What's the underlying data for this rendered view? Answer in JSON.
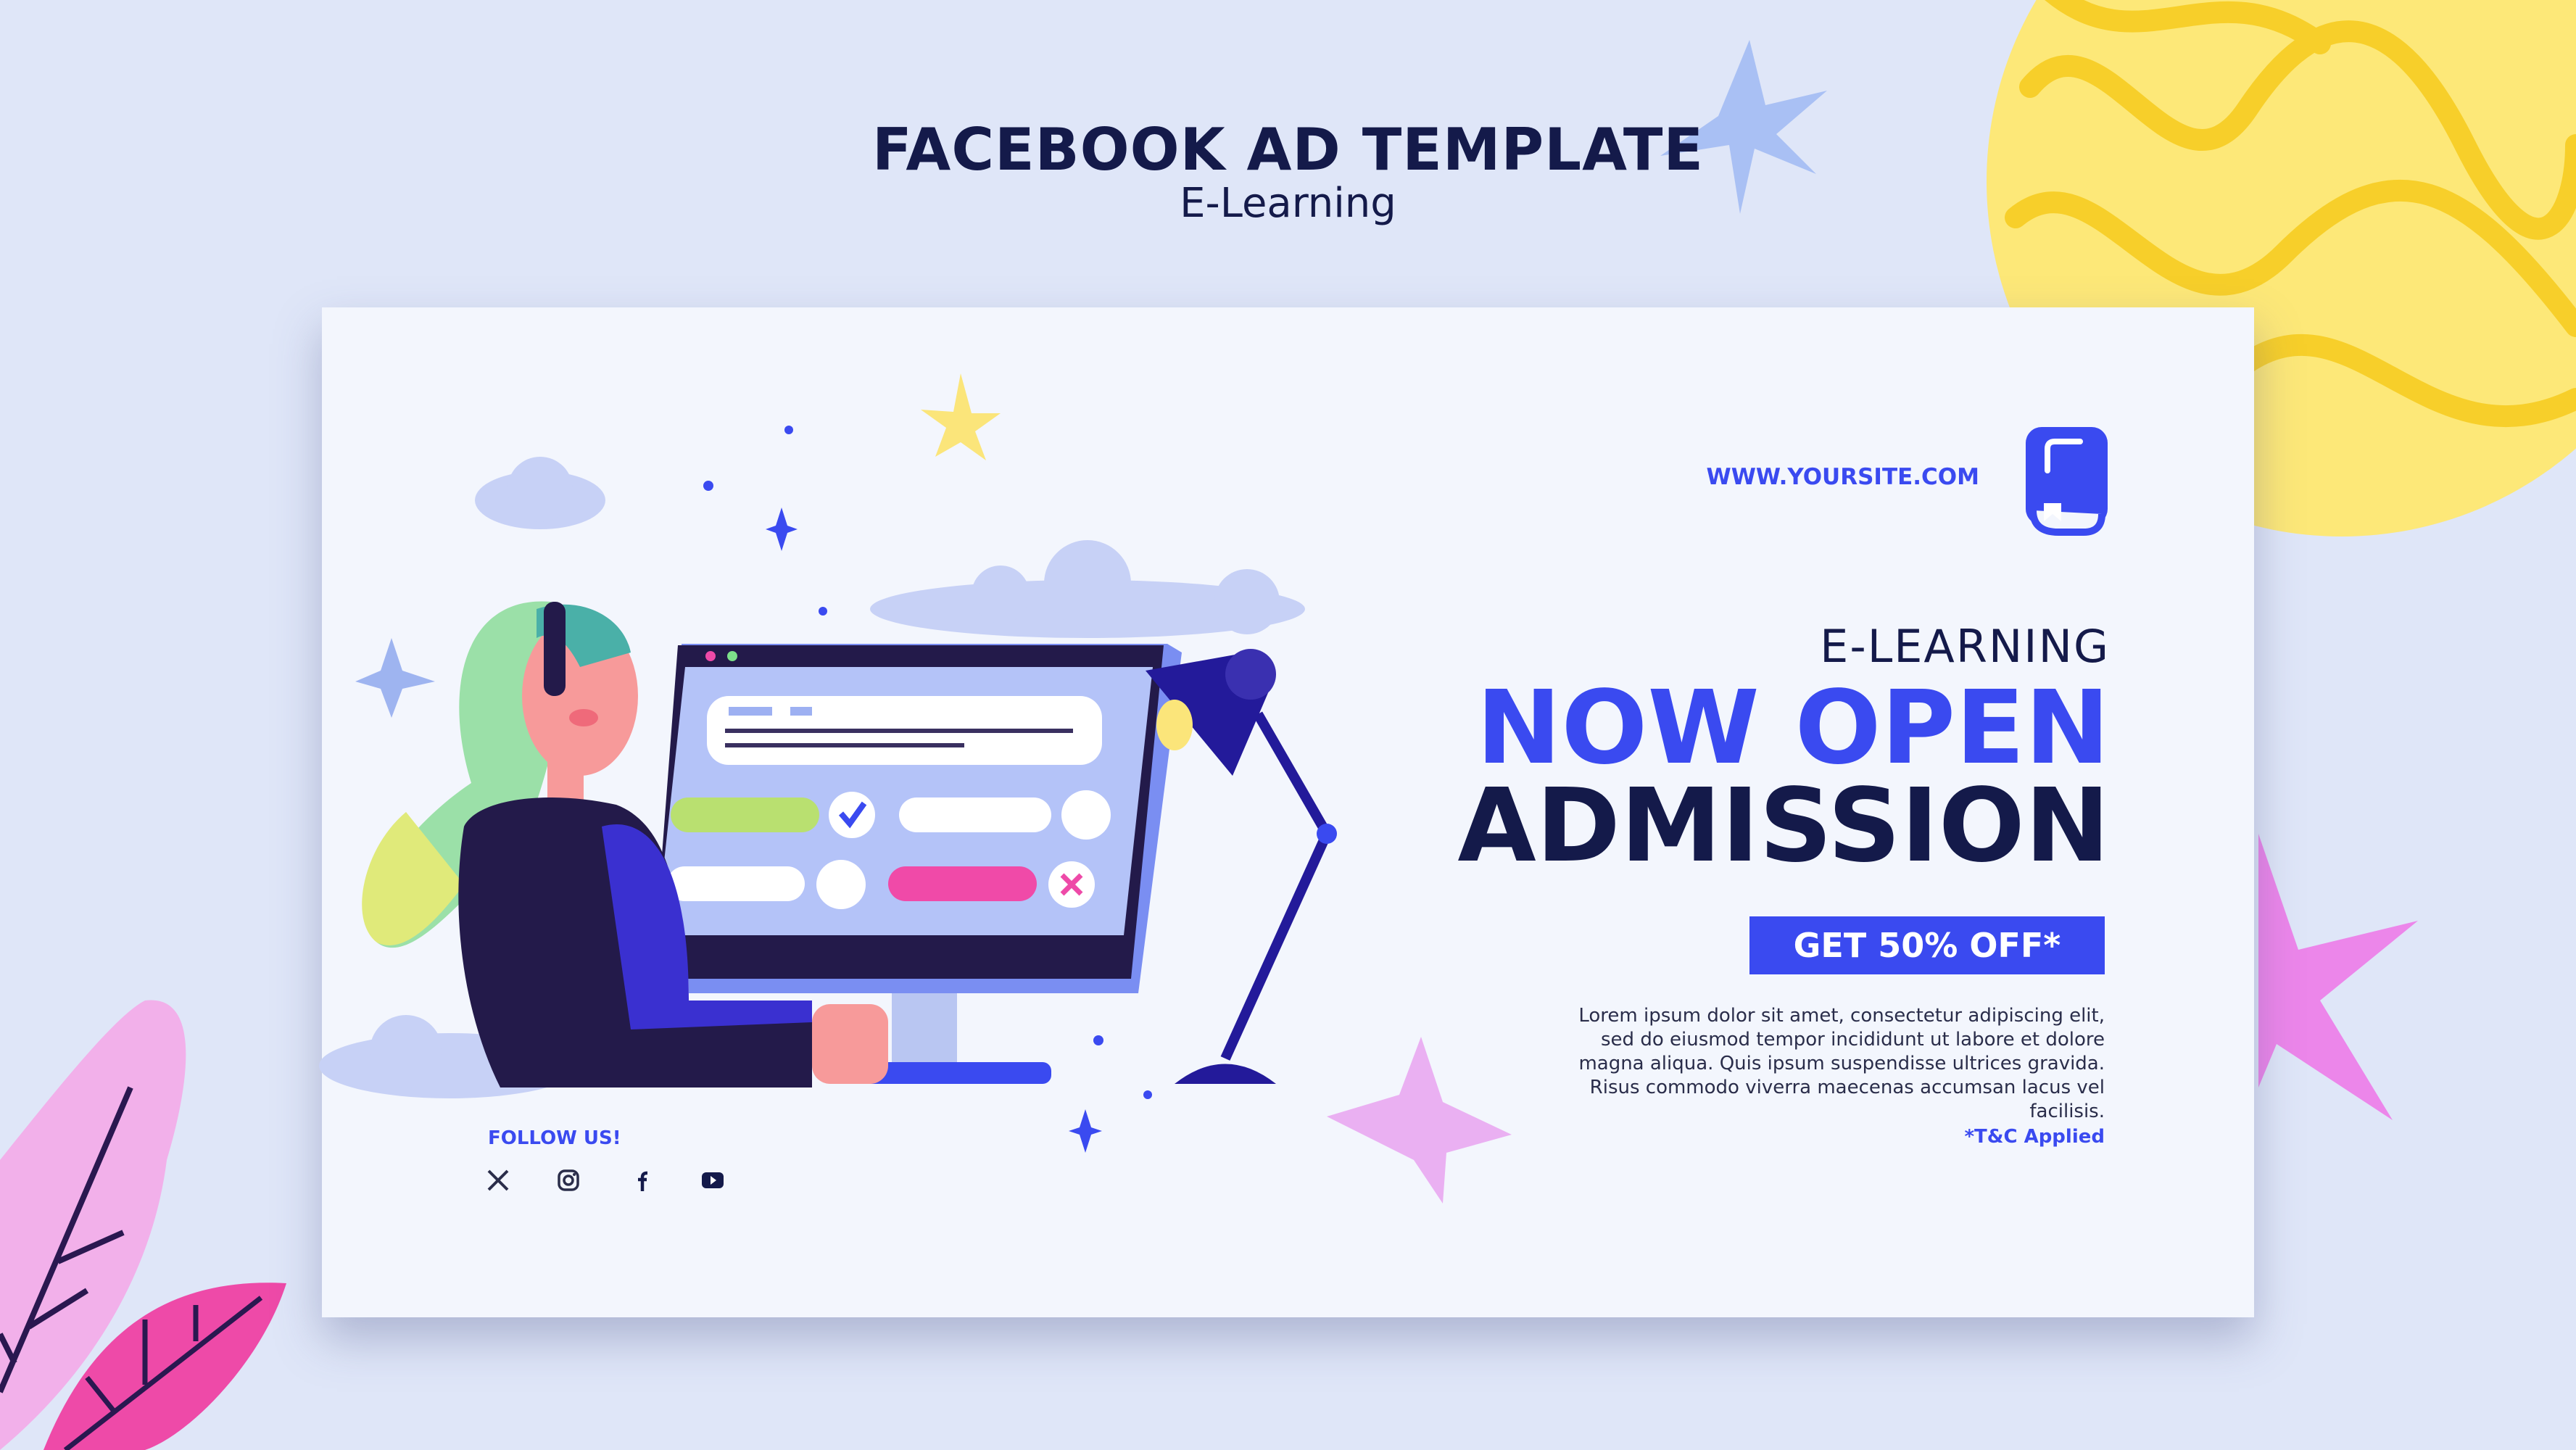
{
  "header": {
    "title": "FACEBOOK AD TEMPLATE",
    "subtitle": "E-Learning"
  },
  "ad": {
    "website": "WWW.YOURSITE.COM",
    "eyebrow": "E-LEARNING",
    "headline_1": "NOW OPEN",
    "headline_2": "ADMISSION",
    "cta_label": "GET 50% OFF*",
    "body": "Lorem ipsum dolor sit amet, consectetur adipiscing elit, sed do eiusmod tempor incididunt ut labore et dolore magna aliqua. Quis ipsum suspendisse ultrices gravida. Risus commodo viverra maecenas accumsan lacus vel facilisis.",
    "terms": "*T&C Applied",
    "follow_label": "FOLLOW US!",
    "social": [
      "x-icon",
      "instagram-icon",
      "facebook-icon",
      "youtube-icon"
    ]
  },
  "colors": {
    "accent": "#3a4af0",
    "dark": "#141a4a",
    "background": "#dfe6f8",
    "card": "#f3f6fd",
    "yellow": "#fde878",
    "pink": "#f07ae0"
  }
}
